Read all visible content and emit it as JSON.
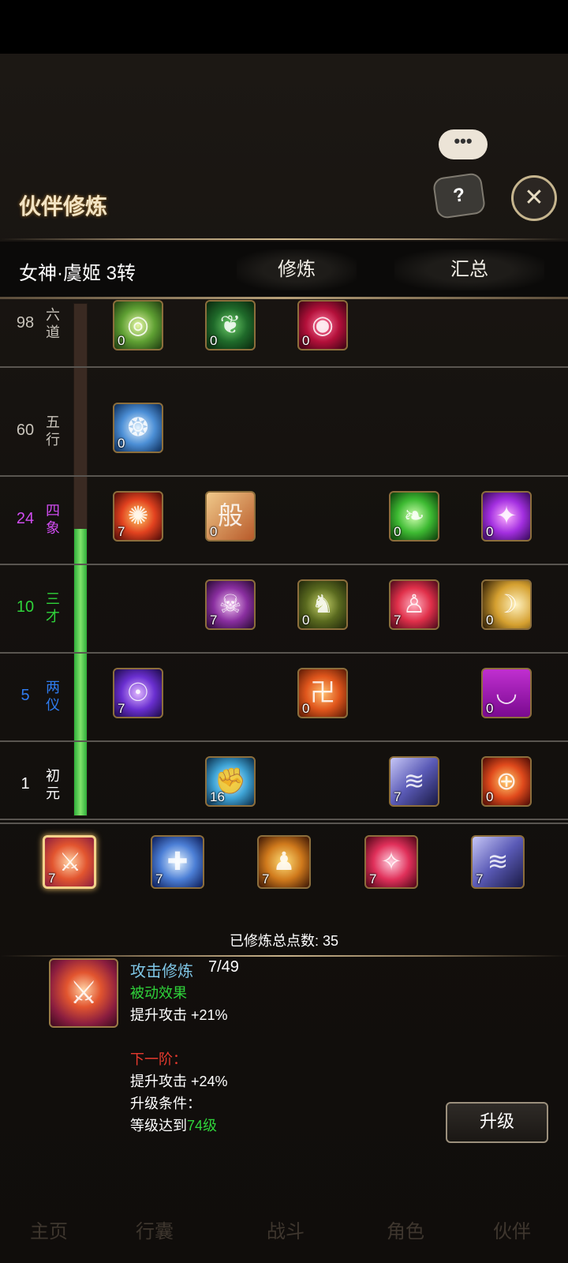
{
  "header": {
    "title": "伙伴修炼",
    "chat": "•••",
    "help": "?",
    "close": "✕"
  },
  "tabs": {
    "partner": "女神·虞姬 3转",
    "train": "修炼",
    "summary": "汇总"
  },
  "rows": [
    {
      "level": "98",
      "rank": [
        "六",
        "道"
      ],
      "color": "#c9c4bb",
      "skills": [
        {
          "count": "0",
          "icon": "green-orb-icon"
        },
        {
          "count": "0",
          "icon": "green-leaf-icon"
        },
        {
          "count": "0",
          "icon": "red-eye-icon"
        }
      ]
    },
    {
      "level": "60",
      "rank": [
        "五",
        "行"
      ],
      "color": "#c9c4bb",
      "skills": [
        {
          "count": "0",
          "icon": "blue-swirl-icon"
        }
      ]
    },
    {
      "level": "24",
      "rank": [
        "四",
        "象"
      ],
      "color": "#d04cf0",
      "skills": [
        {
          "count": "7",
          "icon": "fire-swirl-icon"
        },
        {
          "count": "0",
          "icon": "scroll-icon"
        },
        {
          "count": "0",
          "icon": "green-feather-icon"
        },
        {
          "count": "0",
          "icon": "purple-star-icon"
        }
      ]
    },
    {
      "level": "10",
      "rank": [
        "三",
        "才"
      ],
      "color": "#2fd33a",
      "skills": [
        {
          "count": "7",
          "icon": "skull-icon"
        },
        {
          "count": "0",
          "icon": "warrior-icon"
        },
        {
          "count": "7",
          "icon": "red-figure-icon"
        },
        {
          "count": "0",
          "icon": "gold-silhouette-icon"
        }
      ]
    },
    {
      "level": "5",
      "rank": [
        "两",
        "仪"
      ],
      "color": "#2f7cf0",
      "skills": [
        {
          "count": "7",
          "icon": "purple-angel-icon"
        },
        {
          "count": "0",
          "icon": "red-rune-icon"
        },
        {
          "count": "0",
          "icon": "magenta-drop-icon"
        }
      ]
    },
    {
      "level": "1",
      "rank": [
        "初",
        "元"
      ],
      "color": "#ffffff",
      "skills": [
        {
          "count": "16",
          "icon": "blue-muscle-icon"
        },
        {
          "count": "7",
          "icon": "violet-cloth-icon"
        },
        {
          "count": "0",
          "icon": "target-icon"
        }
      ]
    }
  ],
  "progress": {
    "fill_fraction": 0.56
  },
  "equipped": [
    {
      "count": "7",
      "icon": "attack-icon"
    },
    {
      "count": "7",
      "icon": "shield-icon"
    },
    {
      "count": "7",
      "icon": "gold-figure-icon"
    },
    {
      "count": "7",
      "icon": "pink-burst-icon"
    },
    {
      "count": "7",
      "icon": "violet-cloth-icon"
    }
  ],
  "total_points": "已修炼总点数:  35",
  "detail": {
    "name": "攻击修炼",
    "progress": "7/49",
    "passive_label": "被动效果",
    "current_effect": "提升攻击 +21%",
    "next_label": "下一阶：",
    "next_effect": "提升攻击 +24%",
    "condition_label": "升级条件：",
    "condition_prefix": "等级达到",
    "condition_value": "74级",
    "upgrade_button": "升级"
  },
  "bottom_nav": [
    "主页",
    "行囊",
    "战斗",
    "角色",
    "伙伴"
  ]
}
